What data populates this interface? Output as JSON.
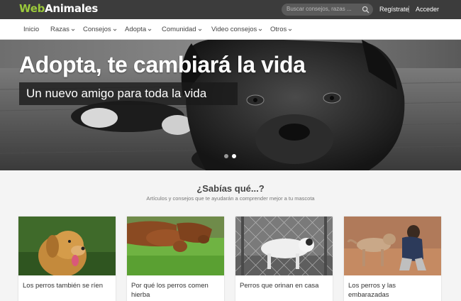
{
  "header": {
    "logo_part1": "Web",
    "logo_part2": "Animales",
    "search_placeholder": "Buscar consejos, razas ...",
    "register_label": "Regístrate",
    "login_label": "Acceder",
    "brand_color": "#9bc93b"
  },
  "nav": {
    "items": [
      {
        "label": "Inicio",
        "has_dropdown": false
      },
      {
        "label": "Razas",
        "has_dropdown": true
      },
      {
        "label": "Consejos",
        "has_dropdown": true
      },
      {
        "label": "Adopta",
        "has_dropdown": true
      },
      {
        "label": "Comunidad",
        "has_dropdown": true
      },
      {
        "label": "Video consejos",
        "has_dropdown": true
      },
      {
        "label": "Otros",
        "has_dropdown": true
      }
    ]
  },
  "hero": {
    "title": "Adopta, te cambiará la vida",
    "subtitle": "Un nuevo amigo para toda la vida",
    "slide_count": 2,
    "active_slide": 2
  },
  "section": {
    "title": "¿Sabías qué...?",
    "subtitle": "Artículos y consejos que te ayudarán a comprender mejor a tu mascota"
  },
  "cards": [
    {
      "title": "Los perros también se ríen"
    },
    {
      "title": "Por qué los perros comen hierba"
    },
    {
      "title": "Perros que orinan en casa"
    },
    {
      "title": "Los perros y las embarazadas"
    }
  ]
}
